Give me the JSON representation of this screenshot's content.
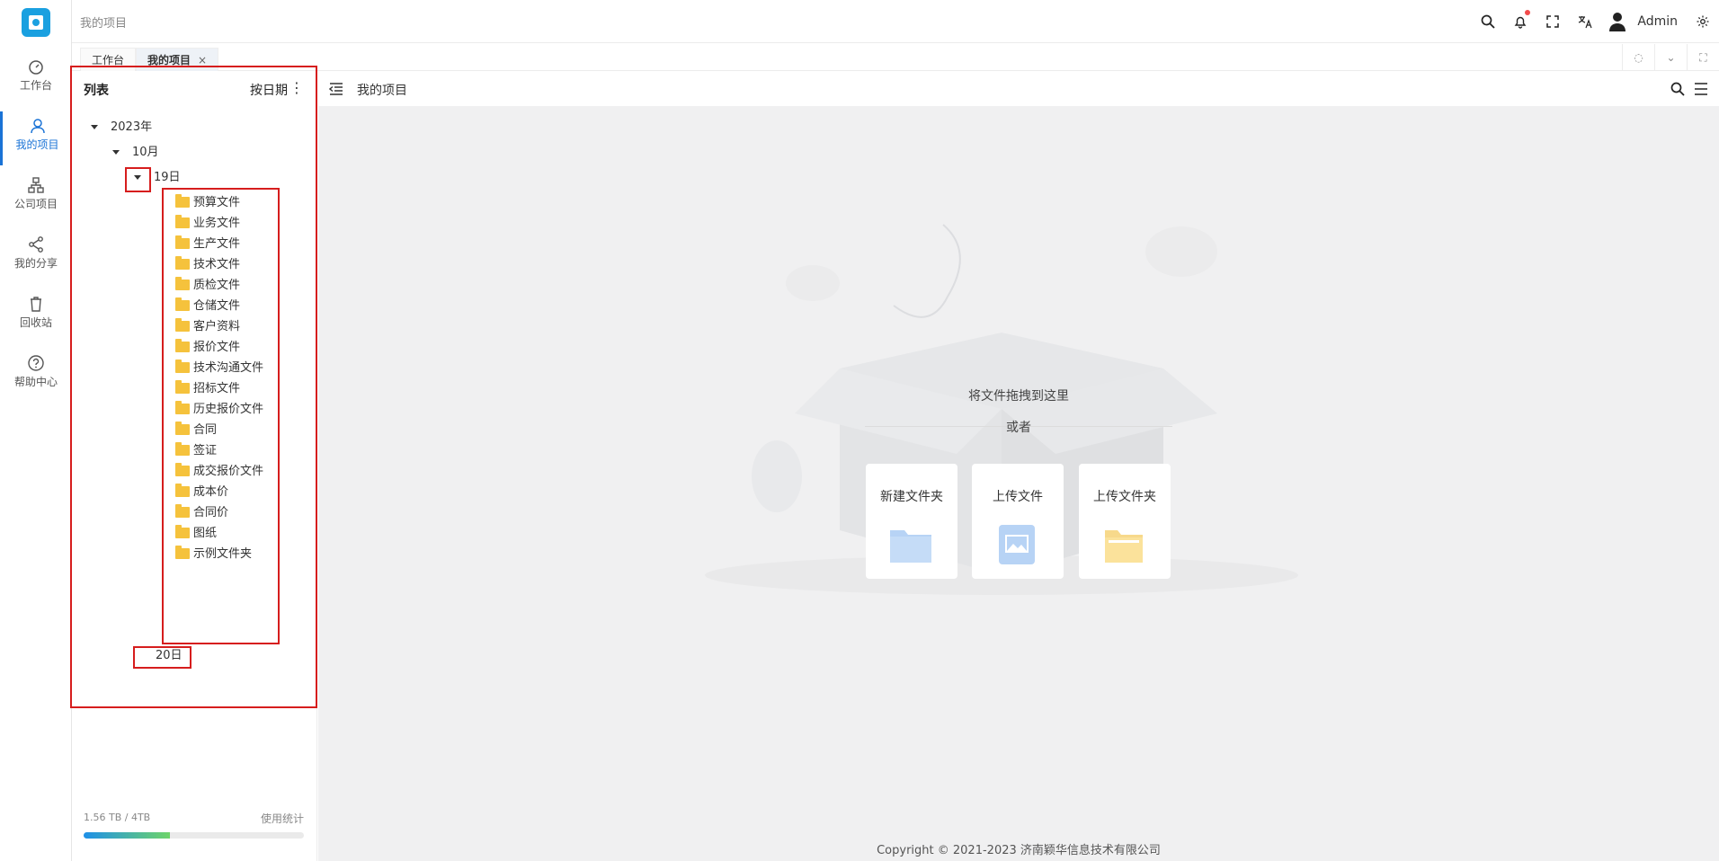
{
  "rail": {
    "items": [
      {
        "label": "工作台",
        "icon": "dashboard-icon"
      },
      {
        "label": "我的项目",
        "icon": "user-icon"
      },
      {
        "label": "公司项目",
        "icon": "org-chart-icon"
      },
      {
        "label": "我的分享",
        "icon": "share-icon"
      },
      {
        "label": "回收站",
        "icon": "trash-icon"
      },
      {
        "label": "帮助中心",
        "icon": "help-icon"
      }
    ],
    "active": "我的项目"
  },
  "topbar": {
    "breadcrumb": "我的项目",
    "user": "Admin",
    "icons": [
      "search-icon",
      "bell-icon",
      "fullscreen-icon",
      "translate-icon",
      "avatar",
      "gear-icon"
    ]
  },
  "tabs": [
    {
      "label": "工作台",
      "closable": false
    },
    {
      "label": "我的项目",
      "closable": true,
      "close": "×"
    }
  ],
  "panel": {
    "title": "列表",
    "sort": "按日期",
    "more": "⋮",
    "tree": {
      "year": "2023年",
      "month": "10月",
      "day1": "19日",
      "folders": [
        "预算文件",
        "业务文件",
        "生产文件",
        "技术文件",
        "质检文件",
        "仓储文件",
        "客户资料",
        "报价文件",
        "技术沟通文件",
        "招标文件",
        "历史报价文件",
        "合同",
        "签证",
        "成交报价文件",
        "成本价",
        "合同价",
        "图纸",
        "示例文件夹"
      ],
      "day2": "20日"
    },
    "usage": {
      "text": "1.56 TB / 4TB",
      "stats_label": "使用统计",
      "fraction": 0.39
    }
  },
  "main": {
    "title": "我的项目",
    "drop_text": "将文件拖拽到这里",
    "or_text": "或者",
    "cards": [
      "新建文件夹",
      "上传文件",
      "上传文件夹"
    ],
    "copyright": "Copyright © 2021-2023 济南颖华信息技术有限公司"
  },
  "colors": {
    "accent": "#1a73d6",
    "annotation": "#d61d1d",
    "folder": "#f5c23c"
  }
}
